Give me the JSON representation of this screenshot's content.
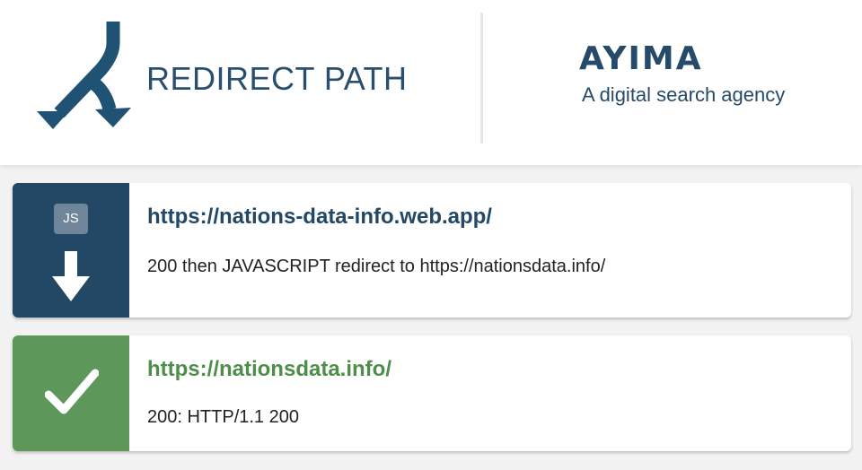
{
  "header": {
    "product_name": "REDIRECT PATH",
    "partner_brand": "AYIMA",
    "partner_tagline": "A digital search agency",
    "logo_icon": "split-arrow-icon"
  },
  "colors": {
    "redirect_tile": "#234865",
    "success_tile": "#5d975a",
    "redirect_link": "#234865",
    "success_link": "#4e8e4a",
    "page_background": "#f2f2f2"
  },
  "hops": [
    {
      "badge": "JS",
      "icon": "arrow-down-icon",
      "url": "https://nations-data-info.web.app/",
      "status": "200 then JAVASCRIPT redirect to https://nationsdata.info/"
    },
    {
      "icon": "checkmark-icon",
      "url": "https://nationsdata.info/",
      "status": "200: HTTP/1.1 200"
    }
  ]
}
